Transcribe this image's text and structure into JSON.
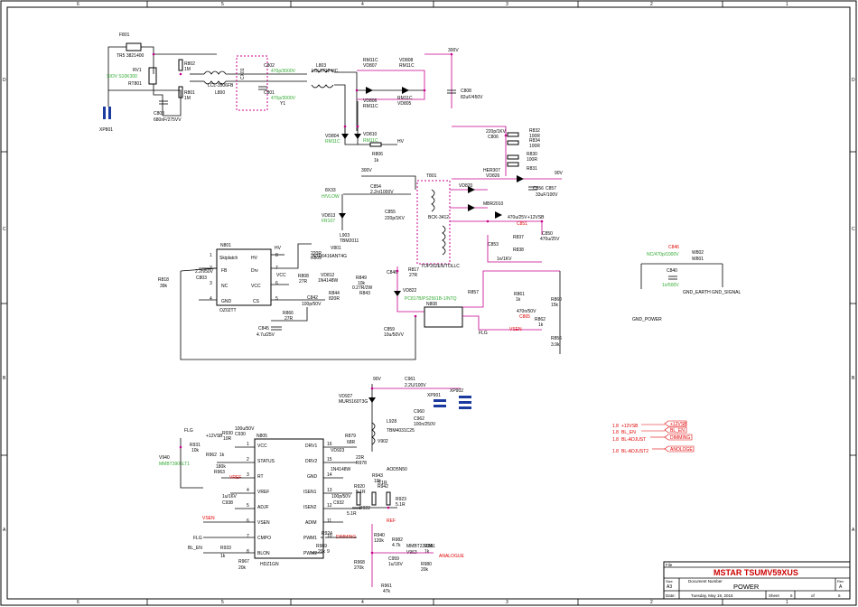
{
  "frame": {
    "columns": [
      "6",
      "5",
      "4",
      "3",
      "2",
      "1"
    ],
    "rows": [
      "D",
      "C",
      "B",
      "A"
    ]
  },
  "title_block": {
    "file_label": "File",
    "title": "MSTAR   TSUMV59XUS",
    "doc_label": "Document Number",
    "doc_title": "POWER",
    "rev_label": "Rev",
    "rev": "A",
    "size_label": "Size",
    "size": "A3",
    "date_label": "Date:",
    "date": "Tuesday, May 19, 2015",
    "sheet_label": "Sheet",
    "sheet_num": "6",
    "of_label": "of",
    "sheet_total": "6"
  },
  "input": {
    "fuse": "F801",
    "fuse_part": "TR5 3821400",
    "rv": "RV1",
    "rv_part": "SIOV S10K300",
    "rt": "RT801",
    "connector": "XP801",
    "r802": "R802",
    "r802v": "1M",
    "r801": "R801",
    "r801v": "1M",
    "c803": "C803",
    "c803v": "680nF/275VV",
    "l800": "L800",
    "l800p": "LCL-3506FB",
    "cx": "CX01",
    "c802": "C802",
    "c802v": "470p/3000V",
    "c801": "C801",
    "c801v": "470p/3000V",
    "y1": "Y1",
    "l803": "L803",
    "l803p": "LCL3712-HC",
    "vd807": "VD807",
    "rm1": "RM11C",
    "vd808": "VD808",
    "rm2": "RM11C",
    "vd806": "VD806",
    "rm3": "RM11C",
    "vd805": "VD805",
    "rm4": "RM11C",
    "v300": "300V",
    "c808": "C808",
    "c808v": "82uF/450V",
    "vd804": "VD804",
    "vd810": "VD810",
    "rm5": "RM11C",
    "rm6": "RM11C",
    "r806": "R806",
    "r806v": "1k",
    "hv": "HV"
  },
  "snubber": {
    "c805": "C806",
    "c805v": "220p/1KV",
    "r832": "R832",
    "r832v": "100R",
    "r834": "R834",
    "r834v": "100R",
    "r830": "R830",
    "r830v": "100R",
    "r831": "R831",
    "her": "HER307",
    "vd826": "VD826",
    "v90": "90V",
    "c856": "C856",
    "c857": "C857",
    "c857v": "33uF/100V",
    "r833": "8X33",
    "c854": "C854",
    "c854v": "2.2n/1000V",
    "hvlow": "H/VLOW",
    "fr107": "FR107",
    "vd813": "VD813",
    "c855": "C855",
    "c855v": "220p/1KV",
    "v300b": "300V",
    "t801": "T801",
    "bck": "BCK-3412",
    "vd820": "VD820",
    "mbr": "MBR2010",
    "v12": "+12VSB",
    "c851": "C851",
    "c851v": "470u/25V",
    "c850": "C850",
    "c850v": "470u/25V",
    "r837": "R837",
    "r838": "R838",
    "c852": "1n/1KV",
    "c853": "C853",
    "part": "TOP262EN/TOLLC"
  },
  "controller": {
    "n801": "N801",
    "ic": "OZ02TT",
    "skip": "Skiplatch",
    "pins_l": [
      "1",
      "2",
      "3",
      "4"
    ],
    "labels_l": [
      "Skiplatch",
      "FB",
      "NC",
      "GND"
    ],
    "pins_r": [
      "8",
      "7",
      "6",
      "5"
    ],
    "labels_r": [
      "HV",
      "Drv",
      "VCC",
      "CS"
    ],
    "r818": "R818",
    "r818v": "39k",
    "c803b": "C803",
    "c803bv": "2.2n/50V",
    "hv": "HV",
    "r809": "R809",
    "r809v": "220R",
    "r808": "R808",
    "r808v": "27R",
    "vd812": "VD812",
    "vd812p": "1N4148W",
    "v801": "V801",
    "v801p": "NTD6416ANT4G",
    "l903": "L903",
    "l903p": "TBM2011",
    "r849": "R849",
    "r849v": "10k",
    "r844": "R844",
    "r844v": "0.27R/2W",
    "r843": "R843",
    "r843v": "820R",
    "c842": "C842",
    "c842v": "100p/50V",
    "vcc": "VCC",
    "r866": "R866",
    "r866v": "27R",
    "c845": "C845",
    "c845v": "4.7u/25V",
    "r817": "R817",
    "r817v": "27R",
    "c846": "C846",
    "c859": "C859",
    "c859v": "10u/50VV",
    "vd822": "VD822",
    "n808": "N808",
    "opto": "PC817B/PS2561B-1/NTQ",
    "r857": "R857",
    "r861": "R861",
    "r861v": "1k",
    "r860": "R860",
    "r860v": "15k",
    "c865": "C865",
    "c865v": "470n/50V",
    "r862": "R862",
    "r862v": "1k",
    "flg": "FLG",
    "vsen": "VSEN",
    "r856": "R856",
    "r856v": "3.9k"
  },
  "ground": {
    "c846": "C846",
    "c846v": "NC/470p/1000V",
    "w802": "W802",
    "w801": "W801",
    "c840": "C840",
    "c840v": "1n/500V",
    "earth": "GND_EARTH",
    "signal": "GND_SIGNAL",
    "power": "GND_POWER"
  },
  "led": {
    "n805": "N805",
    "ic": "HDZ1GN",
    "pins_l": [
      "1",
      "2",
      "3",
      "4",
      "5",
      "6",
      "7",
      "8"
    ],
    "labels_l": [
      "VCC",
      "STATUS",
      "RT",
      "VREF",
      "ADJF",
      "VSEN",
      "CMPO",
      "BLON"
    ],
    "pins_r": [
      "16",
      "15",
      "14",
      "13",
      "12",
      "11",
      "10",
      "9"
    ],
    "labels_r": [
      "DRV1",
      "DRV2",
      "GND",
      "ISEN1",
      "ISEN2",
      "ADIM",
      "PWM1",
      "PWM2"
    ],
    "flg": "FLG",
    "v12": "+12VSB",
    "v940": "V940",
    "v940p": "MMBT3906LT1",
    "r931": "R931",
    "r931v": "10k",
    "r930": "R930",
    "r930v": "10R",
    "c930": "C930",
    "c930v": "100u/50V",
    "r962": "R962",
    "r962v": "1k",
    "r963": "R963",
    "r963v": "180k",
    "vref": "VREF",
    "c938": "C938",
    "c938v": "1u/16V",
    "vsen": "VSEN",
    "flg2": "FLG",
    "blen": "BL_EN",
    "r933": "R933",
    "r933v": "1k",
    "r967": "R967",
    "r967v": "20k",
    "v90": "90V",
    "c961": "C961",
    "c961v": "2.2U/100V",
    "vd927": "VD927",
    "vd927p": "MUR5160T3G",
    "xp901": "XP901",
    "xp902": "XP902",
    "c960": "C960",
    "c962": "C962",
    "c962v": "100n/250V",
    "l928": "L928",
    "l928p": "TBM4031C25",
    "r879": "R879",
    "r879v": "68R",
    "vd923": "VD923",
    "vd923p": "1N4148W",
    "r978": "R978",
    "r978v": "22R",
    "v902": "V902",
    "v902p": "AOD5N50",
    "r943": "R943",
    "r943v": "10k",
    "r920": "R920",
    "r920v": "5.1R",
    "r942": "R942",
    "r942v": "5.1R",
    "r923": "R923",
    "r923v": "5.1R",
    "c932": "C932",
    "c932v": "100p/50V",
    "r922": "R922",
    "r922v": "5.1R",
    "r924": "R924",
    "dimming": "DIMMING",
    "r969": "R969",
    "r969v": "20k",
    "ref": "REF",
    "r940": "R940",
    "r940v": "120k",
    "r982": "R982",
    "r982v": "4.7k",
    "r981": "R981",
    "r981v": "1k",
    "analogue": "ANALOGUE",
    "v963": "V963",
    "v963p": "MMBT2222A",
    "c959": "C959",
    "c959v": "1u/16V",
    "r980": "R980",
    "r980v": "20k",
    "r968": "R968",
    "r968v": "270k",
    "r961": "R961",
    "r961v": "47k"
  },
  "io": [
    {
      "n": "1.8",
      "sig": "+12VSB",
      "dest": "+12VSB"
    },
    {
      "n": "1.8",
      "sig": "BL_EN",
      "dest": "BL_EN"
    },
    {
      "n": "1.8",
      "sig": "BL-ADJUST",
      "dest": "DIMMING"
    },
    {
      "n": "1.8",
      "sig": "BL-ADJUST2",
      "dest": "ANOLOGE"
    }
  ]
}
